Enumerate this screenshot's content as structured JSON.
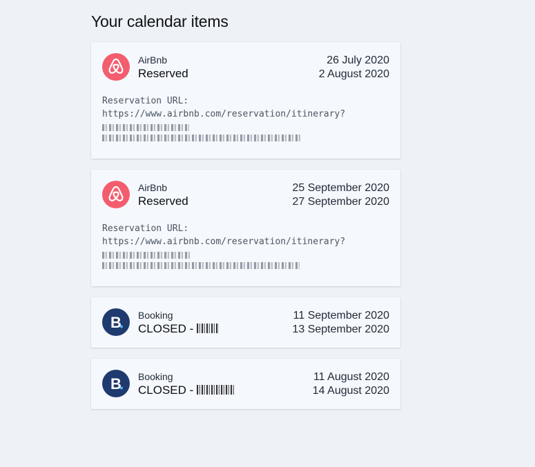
{
  "page": {
    "title": "Your calendar items"
  },
  "items": [
    {
      "provider": "AirBnb",
      "status": "Reserved",
      "start_date": "26 July 2020",
      "end_date": "2 August 2020",
      "notes_label": "Reservation URL:",
      "notes_url": "https://www.airbnb.com/reservation/itinerary?",
      "icon": "airbnb-logo-icon"
    },
    {
      "provider": "AirBnb",
      "status": "Reserved",
      "start_date": "25 September 2020",
      "end_date": "27 September 2020",
      "notes_label": "Reservation URL:",
      "notes_url": "https://www.airbnb.com/reservation/itinerary?",
      "icon": "airbnb-logo-icon"
    },
    {
      "provider": "Booking",
      "status": "CLOSED - ",
      "start_date": "11 September 2020",
      "end_date": "13 September 2020",
      "icon": "booking-logo-icon"
    },
    {
      "provider": "Booking",
      "status": "CLOSED - ",
      "start_date": "11 August 2020",
      "end_date": "14 August 2020",
      "icon": "booking-logo-icon"
    }
  ],
  "colors": {
    "airbnb": "#f35d6e",
    "booking": "#1f3a6e",
    "background": "#eef1f6",
    "card": "#f5f8fc"
  }
}
